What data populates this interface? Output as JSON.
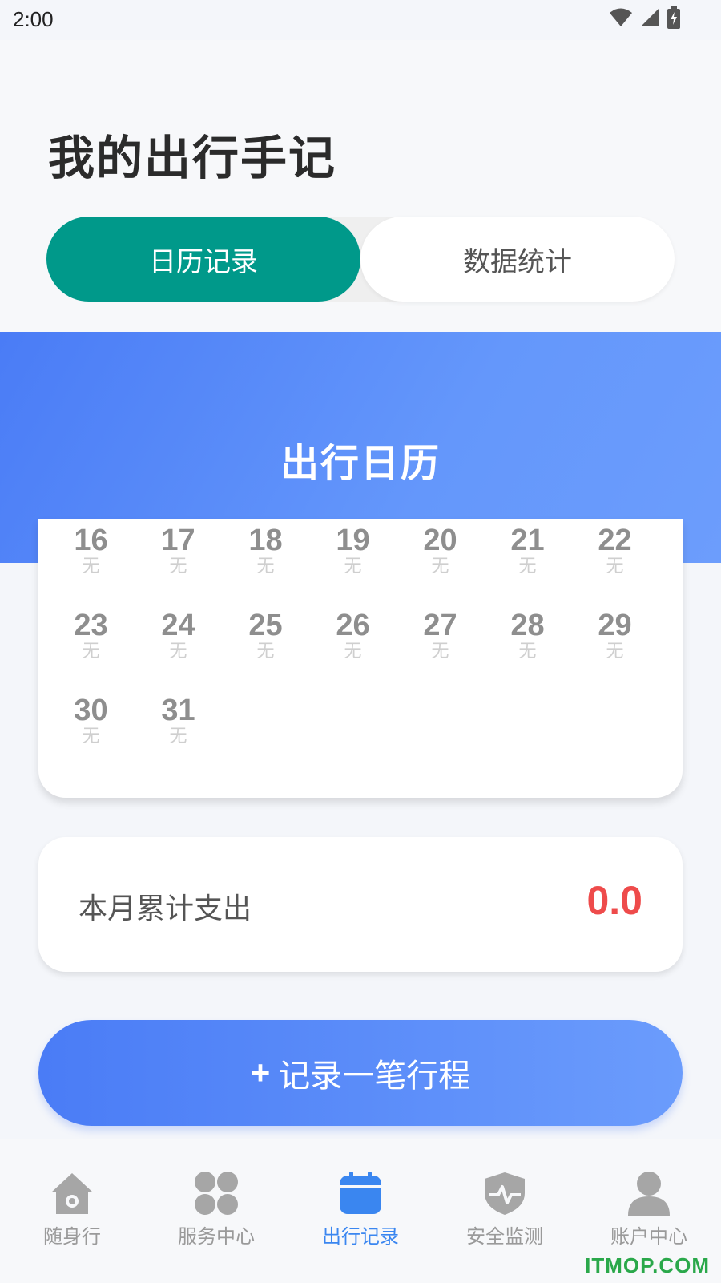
{
  "status_bar": {
    "time": "2:00"
  },
  "page": {
    "title": "我的出行手记"
  },
  "segmented": {
    "tab_calendar": "日历记录",
    "tab_stats": "数据统计"
  },
  "banner": {
    "title": "出行日历"
  },
  "calendar": {
    "rows": [
      [
        {
          "day": "16",
          "note": "无"
        },
        {
          "day": "17",
          "note": "无"
        },
        {
          "day": "18",
          "note": "无"
        },
        {
          "day": "19",
          "note": "无"
        },
        {
          "day": "20",
          "note": "无"
        },
        {
          "day": "21",
          "note": "无"
        },
        {
          "day": "22",
          "note": "无"
        }
      ],
      [
        {
          "day": "23",
          "note": "无"
        },
        {
          "day": "24",
          "note": "无"
        },
        {
          "day": "25",
          "note": "无"
        },
        {
          "day": "26",
          "note": "无"
        },
        {
          "day": "27",
          "note": "无"
        },
        {
          "day": "28",
          "note": "无"
        },
        {
          "day": "29",
          "note": "无"
        }
      ],
      [
        {
          "day": "30",
          "note": "无"
        },
        {
          "day": "31",
          "note": "无"
        }
      ]
    ]
  },
  "expense": {
    "label": "本月累计支出",
    "value": "0.0"
  },
  "add_trip": {
    "plus": "+",
    "label": "记录一笔行程"
  },
  "tabbar": {
    "items": [
      {
        "label": "随身行",
        "icon": "home-icon"
      },
      {
        "label": "服务中心",
        "icon": "grid-icon"
      },
      {
        "label": "出行记录",
        "icon": "calendar-icon",
        "active": true
      },
      {
        "label": "安全监测",
        "icon": "shield-icon"
      },
      {
        "label": "账户中心",
        "icon": "user-icon"
      }
    ]
  },
  "watermark": "ITMOP.COM",
  "colors": {
    "accent_green": "#00998a",
    "accent_blue": "#4a7cf6",
    "expense_red": "#ee4b4b",
    "active_tab": "#3a86f0"
  }
}
